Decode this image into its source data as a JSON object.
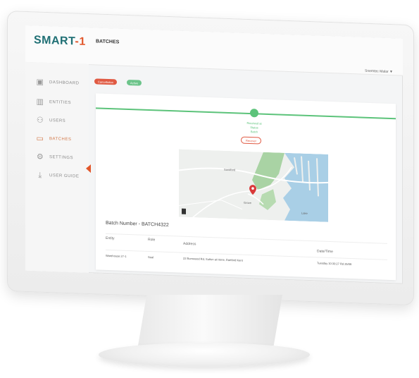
{
  "app": {
    "logo_main": "SMART",
    "logo_accent": "-1",
    "tagline": "",
    "page_title": "BATCHES",
    "user_menu": "Snemtec Malar ▼"
  },
  "sidebar": {
    "items": [
      {
        "label": "DASHBOARD",
        "icon": "dashboard-icon",
        "glyph": "▣"
      },
      {
        "label": "ENTITIES",
        "icon": "entities-icon",
        "glyph": "▥"
      },
      {
        "label": "USERS",
        "icon": "users-icon",
        "glyph": "⚇"
      },
      {
        "label": "BATCHES",
        "icon": "batches-icon",
        "glyph": "▭",
        "active": true
      },
      {
        "label": "SETTINGS",
        "icon": "gear-icon",
        "glyph": "⚙"
      },
      {
        "label": "USER GUIDE",
        "icon": "download-icon",
        "glyph": "⤓"
      }
    ]
  },
  "badges": {
    "red": "Cancellation",
    "green": "Active"
  },
  "tracking": {
    "status_lines": [
      "Received at",
      "Status",
      "Batch"
    ],
    "pill": "Recover"
  },
  "map": {
    "labels": [
      "Sandford",
      "Grove",
      "Lake"
    ]
  },
  "batch": {
    "number_label": "Batch Number - BATCH4322"
  },
  "table": {
    "columns": [
      "Entity",
      "Role",
      "Address",
      "Date/Time"
    ],
    "rows": [
      [
        "Warehouse 27-1",
        "Seal",
        "22 Burnwood Rd, Sutton at Hone, Dartford Kent",
        "Tuesday 10:30:27 Rd 25/09"
      ]
    ]
  },
  "colors": {
    "brand": "#1f6f74",
    "accent": "#e2572b",
    "green": "#5cc37a"
  }
}
